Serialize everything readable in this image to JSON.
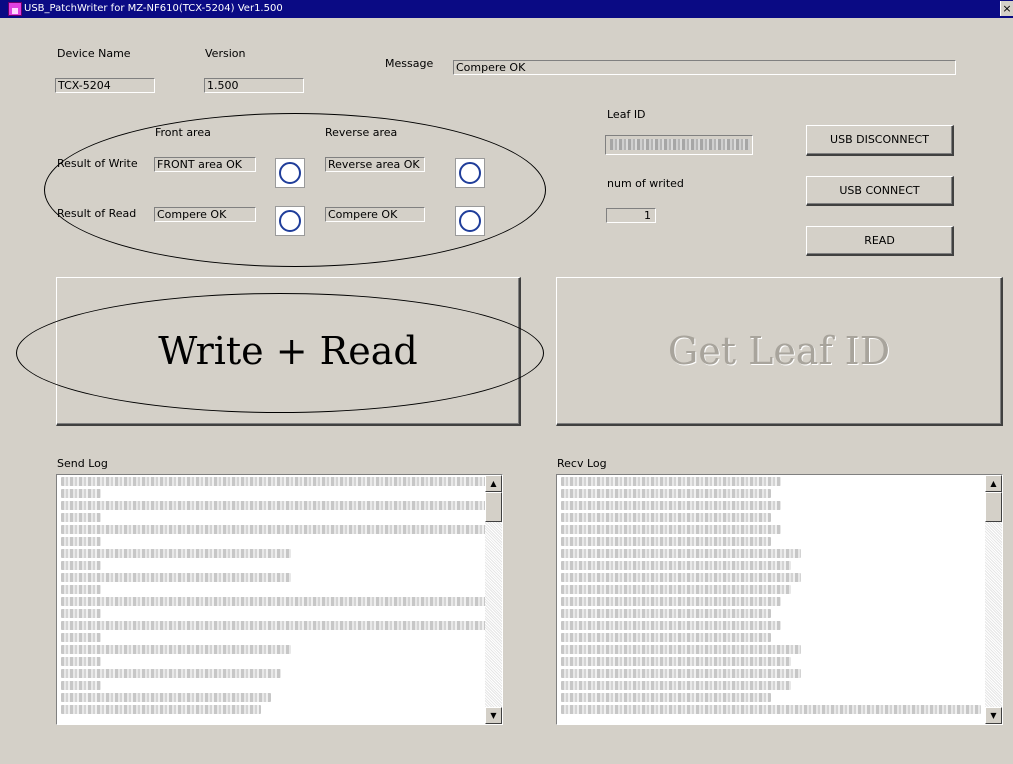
{
  "window": {
    "title": "USB_PatchWriter for MZ-NF610(TCX-5204) Ver1.500",
    "close_symbol": "×"
  },
  "device": {
    "name_label": "Device Name",
    "name_value": "TCX-5204",
    "version_label": "Version",
    "version_value": "1.500"
  },
  "message": {
    "label": "Message",
    "value": "Compere OK"
  },
  "results": {
    "front_header": "Front area",
    "reverse_header": "Reverse area",
    "write_label": "Result of Write",
    "read_label": "Result of Read",
    "write_front": "FRONT area OK",
    "write_reverse": "Reverse area OK",
    "read_front": "Compere OK",
    "read_reverse": "Compere OK"
  },
  "leaf": {
    "id_label": "Leaf ID",
    "num_label": "num of writed",
    "num_value": "1"
  },
  "buttons": {
    "usb_disconnect": "USB DISCONNECT",
    "usb_connect": "USB CONNECT",
    "read": "READ",
    "write_read": "Write + Read",
    "get_leaf_id": "Get Leaf ID"
  },
  "logs": {
    "send_label": "Send Log",
    "recv_label": "Recv Log",
    "scroll_up": "▲",
    "scroll_down": "▼"
  },
  "colors": {
    "titlebar": "#0a0a84",
    "window_bg": "#d4d0c8",
    "indicator_ring": "#1f3d9a"
  },
  "icons": [
    "app-icon",
    "close-icon",
    "ok-circle-icon",
    "scroll-up-icon",
    "scroll-down-icon"
  ]
}
